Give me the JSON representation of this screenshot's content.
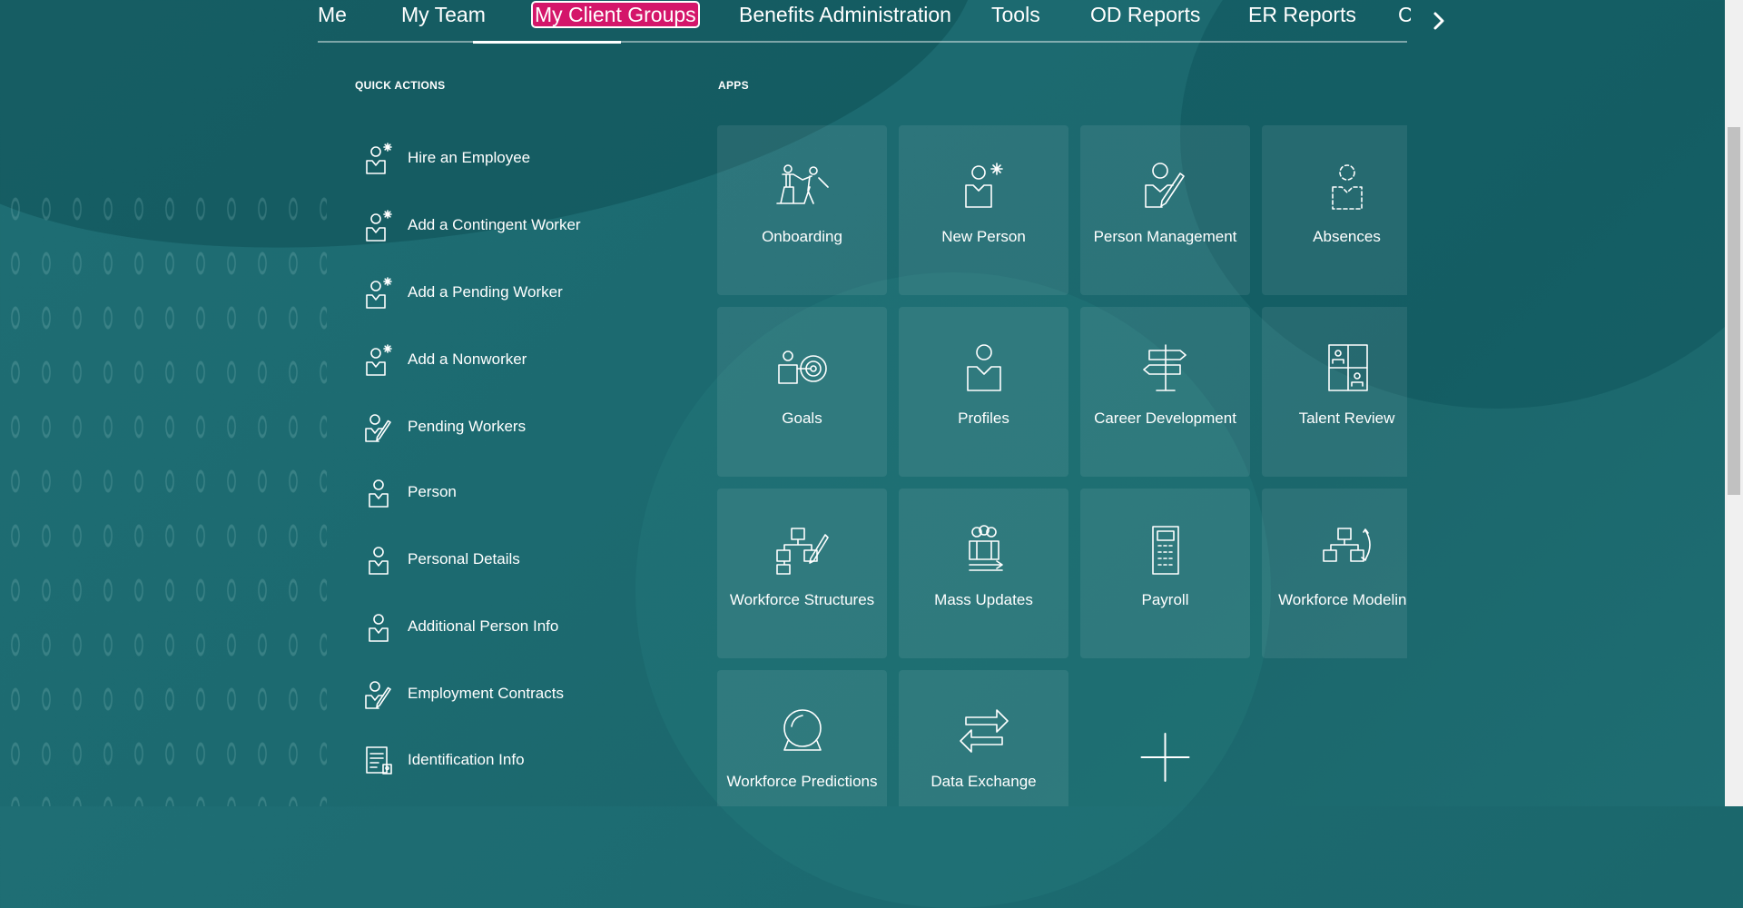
{
  "nav": {
    "tabs": [
      {
        "label": "Me"
      },
      {
        "label": "My Team"
      },
      {
        "label": "My Client Groups"
      },
      {
        "label": "Benefits Administration"
      },
      {
        "label": "Tools"
      },
      {
        "label": "OD Reports"
      },
      {
        "label": "ER Reports"
      },
      {
        "label": "C"
      }
    ],
    "active_tab": "My Client Groups",
    "next_icon": "chevron-right-icon"
  },
  "quick_actions": {
    "title": "QUICK ACTIONS",
    "items": [
      {
        "label": "Hire an Employee",
        "icon": "person-add-icon"
      },
      {
        "label": "Add a Contingent Worker",
        "icon": "person-add-icon"
      },
      {
        "label": "Add a Pending Worker",
        "icon": "person-add-icon"
      },
      {
        "label": "Add a Nonworker",
        "icon": "person-add-icon"
      },
      {
        "label": "Pending Workers",
        "icon": "person-edit-icon"
      },
      {
        "label": "Person",
        "icon": "person-icon"
      },
      {
        "label": "Personal Details",
        "icon": "person-icon"
      },
      {
        "label": "Additional Person Info",
        "icon": "person-icon"
      },
      {
        "label": "Employment Contracts",
        "icon": "person-edit-icon"
      },
      {
        "label": "Identification Info",
        "icon": "id-document-icon"
      }
    ]
  },
  "apps": {
    "title": "APPS",
    "tiles": [
      {
        "label": "Onboarding",
        "icon": "onboarding-icon"
      },
      {
        "label": "New Person",
        "icon": "new-person-icon"
      },
      {
        "label": "Person Management",
        "icon": "person-management-icon"
      },
      {
        "label": "Absences",
        "icon": "absences-icon"
      },
      {
        "label": "Goals",
        "icon": "goals-icon"
      },
      {
        "label": "Profiles",
        "icon": "profiles-icon"
      },
      {
        "label": "Career Development",
        "icon": "signpost-icon"
      },
      {
        "label": "Talent Review",
        "icon": "talent-review-icon"
      },
      {
        "label": "Workforce Structures",
        "icon": "org-chart-icon"
      },
      {
        "label": "Mass Updates",
        "icon": "mass-updates-icon"
      },
      {
        "label": "Payroll",
        "icon": "calculator-icon"
      },
      {
        "label": "Workforce Modeling",
        "icon": "workforce-modeling-icon"
      },
      {
        "label": "Workforce Predictions",
        "icon": "crystal-ball-icon"
      },
      {
        "label": "Data Exchange",
        "icon": "exchange-arrows-icon"
      }
    ],
    "add_icon": "plus-icon"
  },
  "colors": {
    "background": "#1d6b71",
    "active_tab_highlight": "#d4166a",
    "text": "#ffffff"
  }
}
